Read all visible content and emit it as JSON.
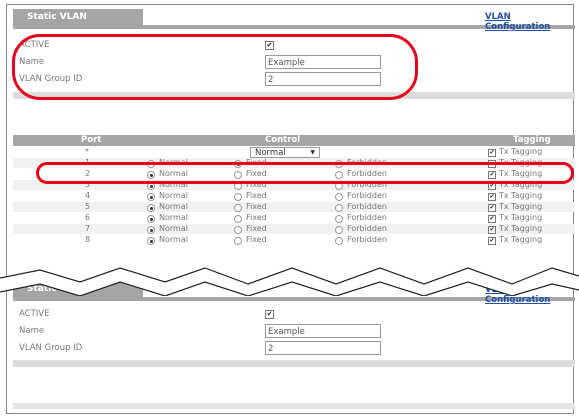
{
  "top_panel": {
    "title": "Static VLAN",
    "config_link": "VLAN Configuration",
    "active_label": "ACTIVE",
    "active_checked": "✔",
    "name_label": "Name",
    "name_value": "Example",
    "group_label": "VLAN Group ID",
    "group_value": "2"
  },
  "port_table": {
    "headers": {
      "port": "Port",
      "control": "Control",
      "tagging": "Tagging"
    },
    "all_row": {
      "port": "*",
      "control_select": "Normal",
      "tag_checked": "✔",
      "tag_label": "Tx Tagging"
    },
    "options": {
      "normal": "Normal",
      "fixed": "Fixed",
      "forbidden": "Forbidden",
      "tag": "Tx Tagging"
    },
    "rows": [
      {
        "port": "1",
        "selected": "fixed",
        "tagged": false,
        "tag_mark": ""
      },
      {
        "port": "2",
        "selected": "normal",
        "tagged": true,
        "tag_mark": "✔"
      },
      {
        "port": "3",
        "selected": "normal",
        "tagged": true,
        "tag_mark": "✔"
      },
      {
        "port": "4",
        "selected": "normal",
        "tagged": true,
        "tag_mark": "✔"
      },
      {
        "port": "5",
        "selected": "normal",
        "tagged": true,
        "tag_mark": "✔"
      },
      {
        "port": "6",
        "selected": "normal",
        "tagged": true,
        "tag_mark": "✔"
      },
      {
        "port": "7",
        "selected": "normal",
        "tagged": true,
        "tag_mark": "✔"
      },
      {
        "port": "8",
        "selected": "normal",
        "tagged": true,
        "tag_mark": "✔"
      }
    ]
  },
  "bottom_panel": {
    "title": "Static VLAN",
    "config_link": "VLAN Configuration",
    "active_label": "ACTIVE",
    "active_checked": "✔",
    "name_label": "Name",
    "name_value": "Example",
    "group_label": "VLAN Group ID",
    "group_value": "2"
  },
  "colors": {
    "annotation": "#e8001c",
    "header": "#a5a5a5",
    "link": "#1f4fa3"
  }
}
